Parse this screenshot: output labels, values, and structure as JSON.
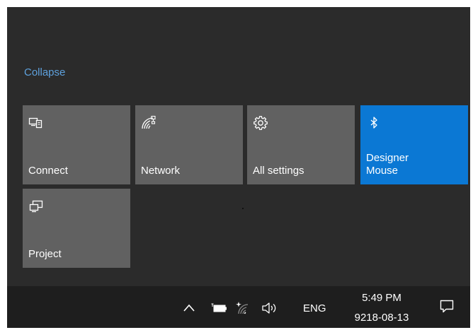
{
  "action_center": {
    "collapse_label": "Collapse",
    "tiles": [
      {
        "label": "Connect",
        "icon": "connect-icon",
        "active": false
      },
      {
        "label": "Network",
        "icon": "network-icon",
        "active": false
      },
      {
        "label": "All settings",
        "icon": "gear-icon",
        "active": false
      },
      {
        "label": "Designer\nMouse",
        "icon": "bluetooth-icon",
        "active": true
      },
      {
        "label": "Project",
        "icon": "project-icon",
        "active": false
      }
    ],
    "accent_color": "#0b78d4",
    "tile_color": "#616161"
  },
  "taskbar": {
    "tray_icons": [
      "chevron-up-icon",
      "battery-icon",
      "wifi-icon",
      "volume-icon"
    ],
    "language": "ENG",
    "time": "5:49 PM",
    "date": "9218-08-13",
    "notification_icon": "action-center-icon"
  }
}
